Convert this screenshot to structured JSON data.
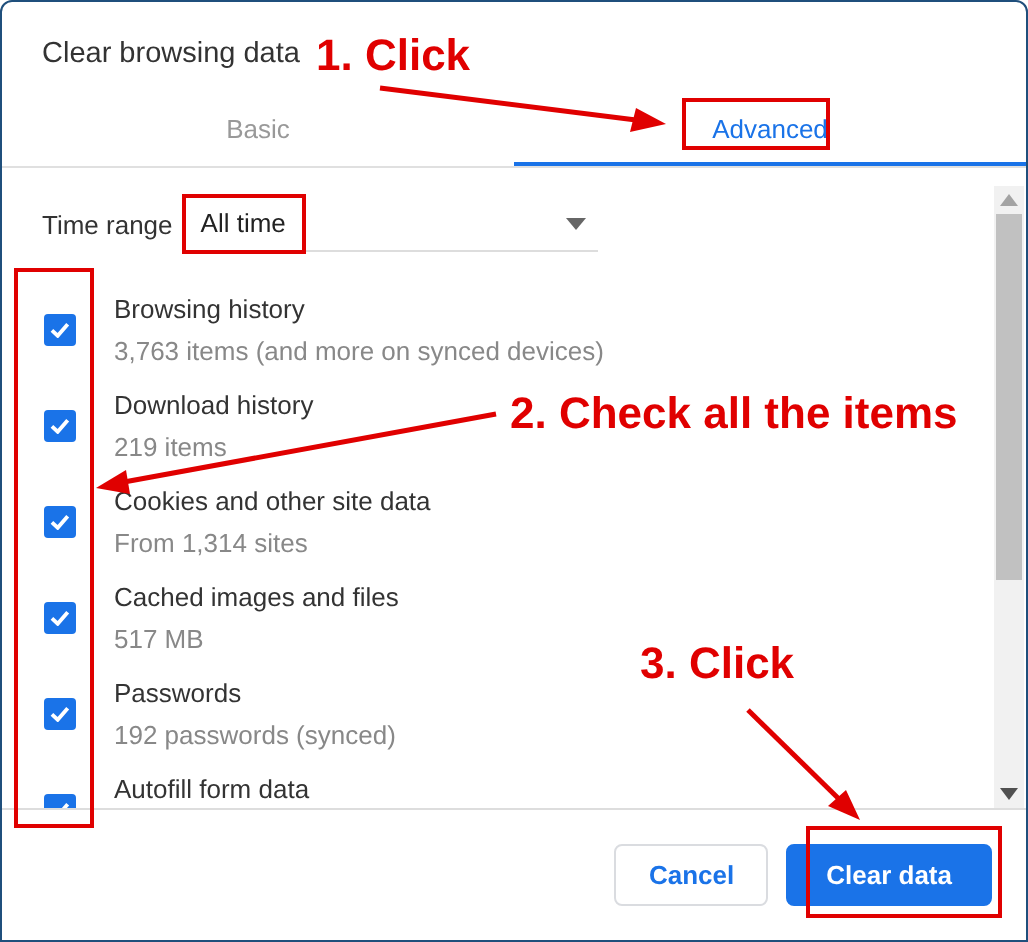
{
  "dialog": {
    "title": "Clear browsing data"
  },
  "tabs": [
    {
      "label": "Basic",
      "selected": false
    },
    {
      "label": "Advanced",
      "selected": true
    }
  ],
  "time_range": {
    "label": "Time range",
    "value": "All time"
  },
  "items": [
    {
      "title": "Browsing history",
      "detail": "3,763 items (and more on synced devices)",
      "checked": true
    },
    {
      "title": "Download history",
      "detail": "219 items",
      "checked": true
    },
    {
      "title": "Cookies and other site data",
      "detail": "From 1,314 sites",
      "checked": true
    },
    {
      "title": "Cached images and files",
      "detail": "517 MB",
      "checked": true
    },
    {
      "title": "Passwords",
      "detail": "192 passwords (synced)",
      "checked": true
    },
    {
      "title": "Autofill form data",
      "checked": true
    }
  ],
  "buttons": [
    {
      "label": "Cancel",
      "kind": "secondary"
    },
    {
      "label": "Clear data",
      "kind": "primary"
    }
  ],
  "annotations": [
    {
      "text": "1. Click"
    },
    {
      "text": "2. Check all the items"
    },
    {
      "text": "3. Click"
    }
  ]
}
